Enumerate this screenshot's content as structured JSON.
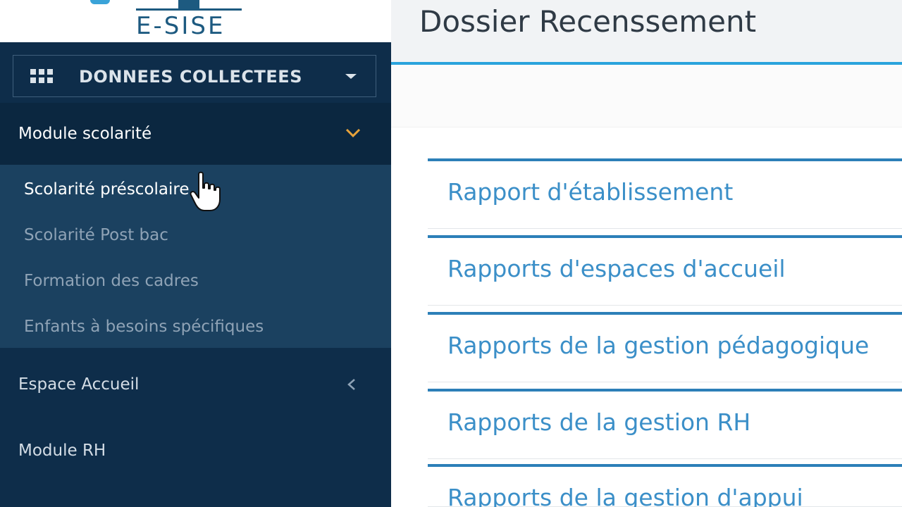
{
  "logo": {
    "text": "E-SISE"
  },
  "sidebar": {
    "dropdown_label": "DONNEES COLLECTEES",
    "module_header": "Module scolarité",
    "submenu": [
      {
        "label": "Scolarité préscolaire",
        "active": true
      },
      {
        "label": "Scolarité Post bac",
        "active": false
      },
      {
        "label": "Formation des cadres",
        "active": false
      },
      {
        "label": "Enfants à besoins spécifiques",
        "active": false
      }
    ],
    "nav_items": [
      {
        "label": "Espace Accueil"
      },
      {
        "label": "Module RH"
      }
    ]
  },
  "main": {
    "title": "Dossier Recenssement",
    "reports": [
      {
        "label": "Rapport d'établissement"
      },
      {
        "label": "Rapports d'espaces d'accueil"
      },
      {
        "label": "Rapports de la gestion pédagogique"
      },
      {
        "label": "Rapports de la gestion RH"
      },
      {
        "label": "Rapports de la gestion d'appui"
      }
    ]
  },
  "colors": {
    "sidebar_bg": "#0e2d4a",
    "submenu_bg": "#1b4160",
    "accent": "#2aa3dc",
    "link": "#3b8fc8",
    "chevron": "#e8a33b"
  },
  "icons": {
    "grid": "grid-icon",
    "caret": "caret-down-icon",
    "module_chevron": "chevron-down-icon",
    "espace_chevron": "chevron-left-icon",
    "cursor": "hand-cursor-icon"
  }
}
